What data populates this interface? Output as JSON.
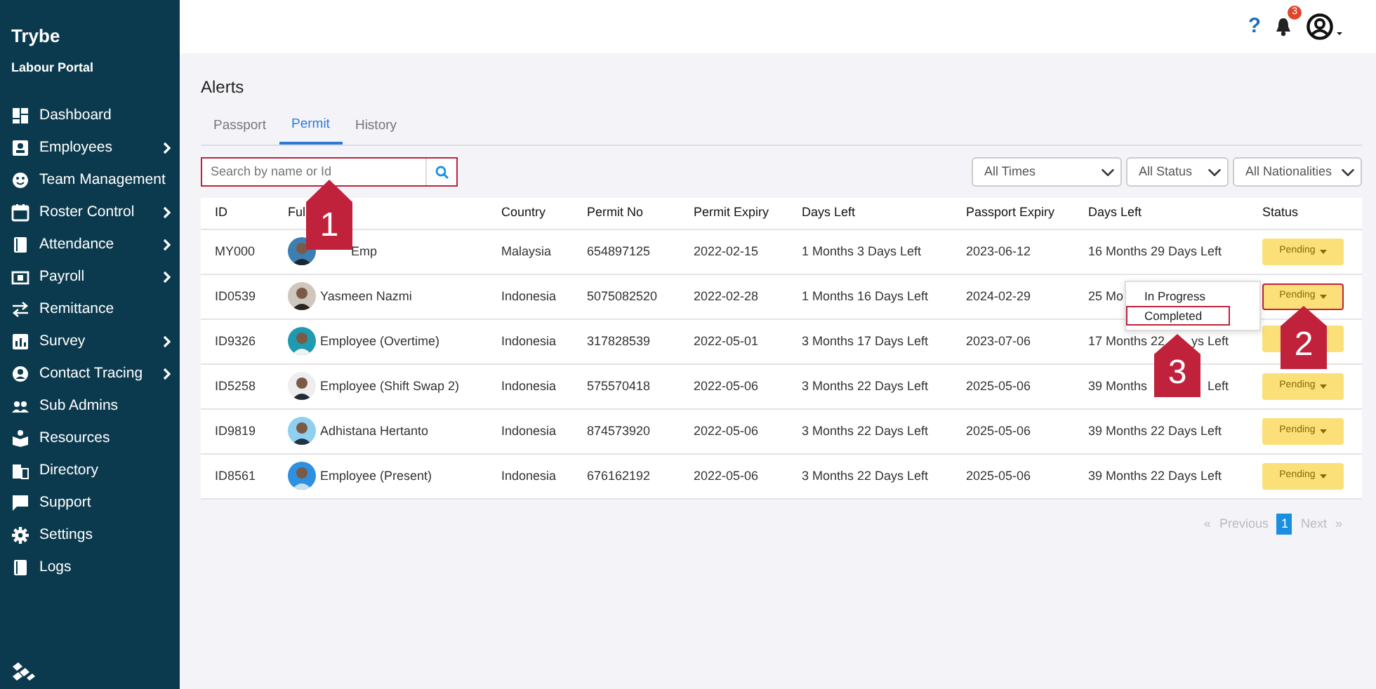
{
  "sidebar": {
    "brand": "Trybe",
    "subtitle": "Labour Portal",
    "items": [
      {
        "label": "Dashboard",
        "has_submenu": false
      },
      {
        "label": "Employees",
        "has_submenu": true
      },
      {
        "label": "Team Management",
        "has_submenu": false
      },
      {
        "label": "Roster Control",
        "has_submenu": true
      },
      {
        "label": "Attendance",
        "has_submenu": true
      },
      {
        "label": "Payroll",
        "has_submenu": true
      },
      {
        "label": "Remittance",
        "has_submenu": false
      },
      {
        "label": "Survey",
        "has_submenu": true
      },
      {
        "label": "Contact Tracing",
        "has_submenu": true
      },
      {
        "label": "Sub Admins",
        "has_submenu": false
      },
      {
        "label": "Resources",
        "has_submenu": false
      },
      {
        "label": "Directory",
        "has_submenu": false
      },
      {
        "label": "Support",
        "has_submenu": false
      },
      {
        "label": "Settings",
        "has_submenu": false
      },
      {
        "label": "Logs",
        "has_submenu": false
      }
    ]
  },
  "header": {
    "help": "?",
    "notifications": "3"
  },
  "page_title": "Alerts",
  "tabs": [
    {
      "label": "Passport",
      "selected": false
    },
    {
      "label": "Permit",
      "selected": true
    },
    {
      "label": "History",
      "selected": false
    }
  ],
  "search": {
    "placeholder": "Search by name or Id",
    "outlined": true
  },
  "filters": [
    {
      "value": "All Times"
    },
    {
      "value": "All Status"
    },
    {
      "value": "All Nationalities"
    }
  ],
  "table": {
    "columns": [
      "ID",
      "Ful",
      "Country",
      "Permit No",
      "Permit Expiry",
      "Days Left",
      "Passport Expiry",
      "Days Left",
      "Status"
    ],
    "rows": [
      {
        "cells": [
          "MY000",
          "Emp",
          "Malaysia",
          "654897125",
          "2022-02-15",
          "1 Months 3 Days Left",
          "2023-06-12",
          [
            "16 Months 29 Days Left"
          ]
        ],
        "status": {
          "text": "Pending",
          "outlined": false
        },
        "name_covered": true
      },
      {
        "cells": [
          "ID0539",
          "Yasmeen Nazmi",
          "Indonesia",
          "5075082520",
          "2022-02-28",
          "1 Months 16 Days Left",
          "2024-02-29",
          [
            "25 Mo"
          ]
        ],
        "status": {
          "text": "Pending",
          "outlined": true,
          "menu": [
            {
              "label": "In Progress",
              "outlined": false
            },
            {
              "label": "Completed",
              "outlined": true
            }
          ]
        }
      },
      {
        "cells": [
          "ID9326",
          "Employee (Overtime)",
          "Indonesia",
          "317828539",
          "2022-05-01",
          "3 Months 17 Days Left",
          "2023-07-06",
          [
            "17 Months 22",
            "ys Left"
          ]
        ],
        "status": {
          "outlined": false
        }
      },
      {
        "cells": [
          "ID5258",
          "Employee (Shift Swap 2)",
          "Indonesia",
          "575570418",
          "2022-05-06",
          "3 Months 22 Days Left",
          "2025-05-06",
          [
            "39 Months",
            "Left"
          ]
        ],
        "status": {
          "text": "Pending",
          "outlined": false
        }
      },
      {
        "cells": [
          "ID9819",
          "Adhistana Hertanto",
          "Indonesia",
          "874573920",
          "2022-05-06",
          "3 Months 22 Days Left",
          "2025-05-06",
          [
            "39 Months 22 Days Left"
          ]
        ],
        "status": {
          "text": "Pending",
          "outlined": false
        }
      },
      {
        "cells": [
          "ID8561",
          "Employee (Present)",
          "Indonesia",
          "676162192",
          "2022-05-06",
          "3 Months 22 Days Left",
          "2025-05-06",
          [
            "39 Months 22 Days Left"
          ]
        ],
        "status": {
          "text": "Pending",
          "outlined": false
        }
      }
    ]
  },
  "pagination": [
    {
      "label": "«",
      "selected": false,
      "disabled": true
    },
    {
      "label": "Previous",
      "selected": false,
      "disabled": true
    },
    {
      "label": "1",
      "selected": true,
      "disabled": false
    },
    {
      "label": "Next",
      "selected": false,
      "disabled": true
    },
    {
      "label": "»",
      "selected": false,
      "disabled": true
    }
  ],
  "callouts": [
    "1",
    "2",
    "3"
  ]
}
